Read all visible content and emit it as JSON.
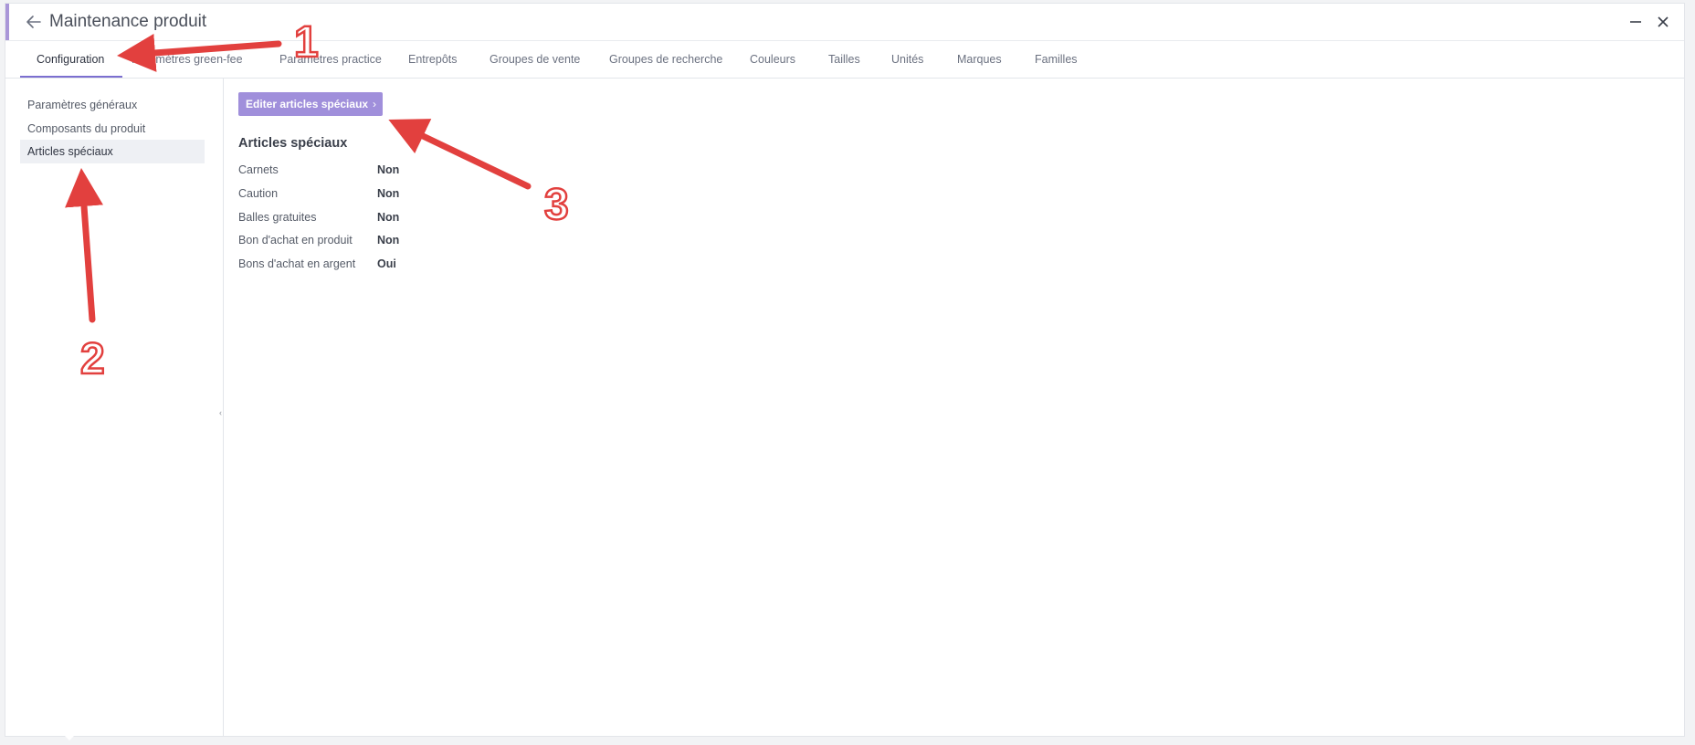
{
  "window": {
    "title": "Maintenance produit",
    "accent_color": "#a996d8"
  },
  "icons": {
    "back": "arrow-left-icon",
    "minimize": "minimize-icon",
    "close": "close-icon"
  },
  "tabs": [
    {
      "label": "Configuration",
      "active": true
    },
    {
      "label": "Paramètres green-fee"
    },
    {
      "label": "Paramètres practice"
    },
    {
      "label": "Entrepôts"
    },
    {
      "label": "Groupes de vente"
    },
    {
      "label": "Groupes de recherche"
    },
    {
      "label": "Couleurs"
    },
    {
      "label": "Tailles"
    },
    {
      "label": "Unités"
    },
    {
      "label": "Marques"
    },
    {
      "label": "Familles"
    }
  ],
  "sidebar": {
    "items": [
      {
        "label": "Paramètres généraux"
      },
      {
        "label": "Composants du produit"
      },
      {
        "label": "Articles spéciaux",
        "active": true
      }
    ]
  },
  "main": {
    "edit_button": "Editer articles spéciaux",
    "edit_button_chevron": "›",
    "section_title": "Articles spéciaux",
    "rows": [
      {
        "label": "Carnets",
        "value": "Non"
      },
      {
        "label": "Caution",
        "value": "Non"
      },
      {
        "label": "Balles gratuites",
        "value": "Non"
      },
      {
        "label": "Bon d'achat en produit",
        "value": "Non"
      },
      {
        "label": "Bons d'achat en argent",
        "value": "Oui"
      }
    ]
  },
  "annotations": {
    "color": "#e2403e",
    "labels": [
      "1",
      "2",
      "3"
    ]
  },
  "colors": {
    "button": "#a08fdb",
    "tab_underline": "#7c6fd0",
    "active_bg": "#eef0f4"
  }
}
